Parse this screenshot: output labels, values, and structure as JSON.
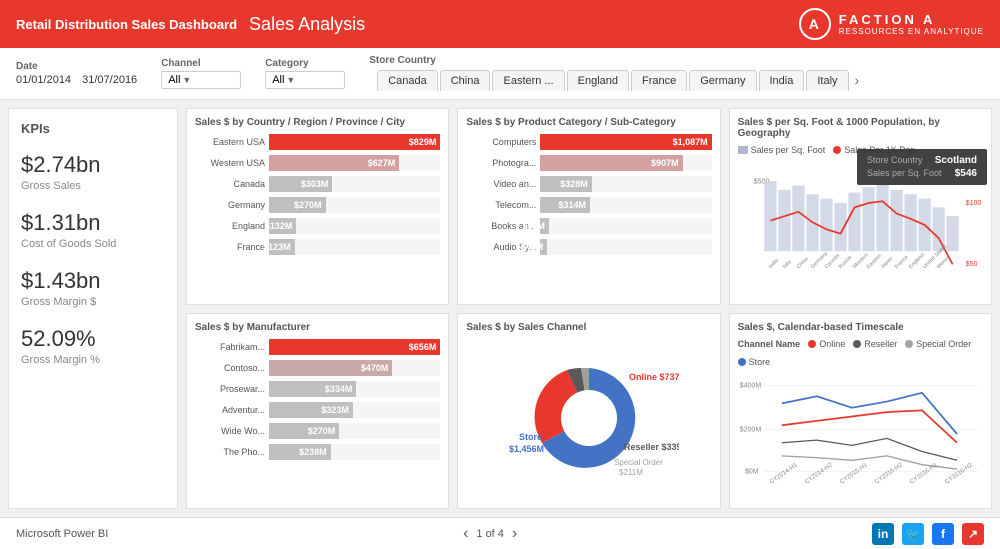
{
  "header": {
    "title_main": "Retail Distribution Sales Dashboard",
    "title_sub": "Sales Analysis",
    "logo_letter": "A",
    "logo_name": "FACTION A",
    "logo_tagline": "RESSOURCES EN ANALYTIQUE"
  },
  "filters": {
    "date_label": "Date",
    "date_from": "01/01/2014",
    "date_to": "31/07/2016",
    "channel_label": "Channel",
    "channel_value": "All",
    "category_label": "Category",
    "category_value": "All",
    "store_country_label": "Store Country"
  },
  "country_tabs": [
    "Canada",
    "China",
    "Eastern ...",
    "England",
    "France",
    "Germany",
    "India",
    "Italy"
  ],
  "kpis": {
    "title": "KPIs",
    "items": [
      {
        "value": "$2.74bn",
        "label": "Gross Sales"
      },
      {
        "value": "$1.31bn",
        "label": "Cost of Goods Sold"
      },
      {
        "value": "$1.43bn",
        "label": "Gross Margin $"
      },
      {
        "value": "52.09%",
        "label": "Gross Margin %"
      }
    ]
  },
  "charts": {
    "by_country": {
      "title": "Sales $ by Country / Region / Province / City",
      "bars": [
        {
          "label": "Eastern USA",
          "value": "$829M",
          "pct": 100,
          "color": "#e8382d"
        },
        {
          "label": "Western USA",
          "value": "$627M",
          "pct": 76,
          "color": "#d4a0a0"
        },
        {
          "label": "Canada",
          "value": "$303M",
          "pct": 37,
          "color": "#c0bfbf"
        },
        {
          "label": "Germany",
          "value": "$270M",
          "pct": 33,
          "color": "#c0bfbf"
        },
        {
          "label": "England",
          "value": "$132M",
          "pct": 16,
          "color": "#c0bfbf"
        },
        {
          "label": "France",
          "value": "$123M",
          "pct": 15,
          "color": "#c0bfbf"
        }
      ]
    },
    "by_product": {
      "title": "Sales $ by Product Category / Sub-Category",
      "bars": [
        {
          "label": "Computers",
          "value": "$1,087M",
          "pct": 100,
          "color": "#e8382d"
        },
        {
          "label": "Photogra...",
          "value": "$907M",
          "pct": 83,
          "color": "#d4a0a0"
        },
        {
          "label": "Video an...",
          "value": "$328M",
          "pct": 30,
          "color": "#c0bfbf"
        },
        {
          "label": "Telecom...",
          "value": "$314M",
          "pct": 29,
          "color": "#c0bfbf"
        },
        {
          "label": "Books an...",
          "value": "$59M",
          "pct": 5,
          "color": "#c0bfbf"
        },
        {
          "label": "Audio Sy...",
          "value": "$48M",
          "pct": 4,
          "color": "#c0bfbf"
        }
      ]
    },
    "by_geography": {
      "title": "Sales $ per Sq. Foot & 1000 Population, by Geography",
      "legend_bar": "Sales per Sq. Foot",
      "legend_line": "Sales Per 1K Pop",
      "y_axis_left": "$500",
      "y_axis_right_top": "$100",
      "y_axis_right_bottom": "$50"
    },
    "by_manufacturer": {
      "title": "Sales $ by Manufacturer",
      "bars": [
        {
          "label": "Fabrikam...",
          "value": "$656M",
          "pct": 100,
          "color": "#e8382d"
        },
        {
          "label": "Contoso...",
          "value": "$470M",
          "pct": 72,
          "color": "#c8a8a8"
        },
        {
          "label": "Prosewar...",
          "value": "$334M",
          "pct": 51,
          "color": "#c0bfbf"
        },
        {
          "label": "Adventur...",
          "value": "$323M",
          "pct": 49,
          "color": "#c0bfbf"
        },
        {
          "label": "Wide Wo...",
          "value": "$270M",
          "pct": 41,
          "color": "#c0bfbf"
        },
        {
          "label": "The Pho...",
          "value": "$238M",
          "pct": 36,
          "color": "#c0bfbf"
        }
      ]
    },
    "by_channel": {
      "title": "Sales $ by Sales Channel",
      "segments": [
        {
          "label": "Store",
          "value": "$1,456M",
          "color": "#4472C4",
          "pct": 59
        },
        {
          "label": "Online",
          "value": "$737M",
          "color": "#e8382d",
          "pct": 30
        },
        {
          "label": "Reseller",
          "value": "$339M",
          "color": "#595959",
          "pct": 8
        },
        {
          "label": "Special Order",
          "value": "$211M",
          "color": "#a0a0a0",
          "pct": 3
        }
      ]
    },
    "timescale": {
      "title": "Sales $, Calendar-based Timescale",
      "legend": [
        {
          "label": "Online",
          "color": "#e8382d"
        },
        {
          "label": "Reseller",
          "color": "#595959"
        },
        {
          "label": "Special Order",
          "color": "#a0a0a0"
        },
        {
          "label": "Store",
          "color": "#4472C4"
        }
      ],
      "x_labels": [
        "CY2014-H1",
        "CY2014-H2",
        "CY2015-H1",
        "CY2015-H2",
        "CY2016-H1",
        "CY2016-H2"
      ],
      "y_labels": [
        "$400M",
        "$200M",
        "$0M"
      ]
    }
  },
  "tooltip": {
    "title_label": "Store Country",
    "title_value": "Scotland",
    "row_label": "Sales per Sq. Foot",
    "row_value": "$546"
  },
  "footer": {
    "app_name": "Microsoft Power BI",
    "page_info": "1 of 4",
    "prev": "‹",
    "next": "›"
  }
}
